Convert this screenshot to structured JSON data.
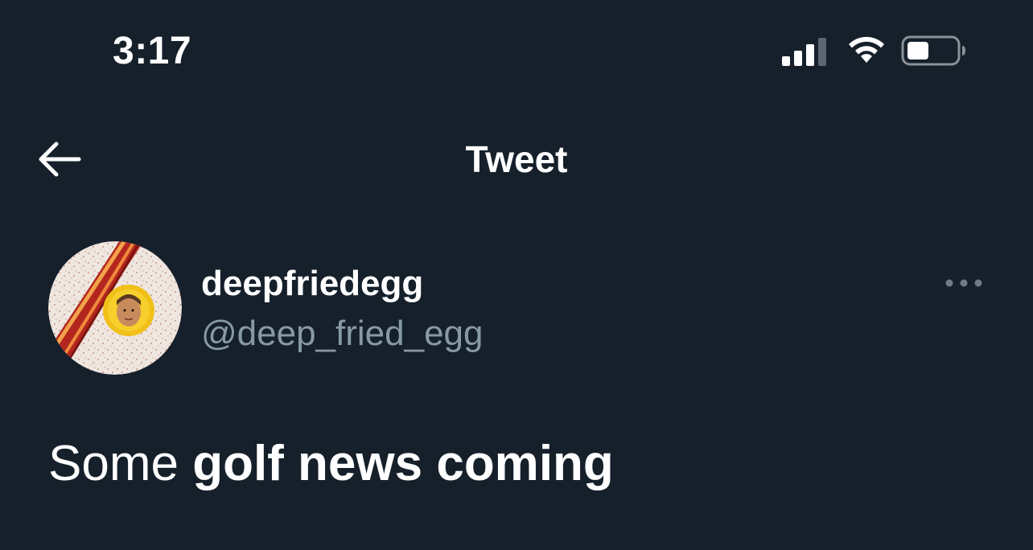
{
  "status_bar": {
    "time": "3:17",
    "icons": [
      "signal-icon",
      "wifi-icon",
      "battery-icon"
    ]
  },
  "header": {
    "title": "Tweet",
    "back_icon": "back-arrow-icon"
  },
  "tweet": {
    "author": {
      "display_name": "deepfriedegg",
      "handle": "@deep_fried_egg",
      "avatar": "fried-egg-bacon-avatar"
    },
    "more_icon": "more-horizontal-icon",
    "text_normal": "Some ",
    "text_bold": "golf news coming"
  },
  "colors": {
    "background": "#15202b",
    "primary_text": "#ffffff",
    "secondary_text": "#8899a6"
  }
}
